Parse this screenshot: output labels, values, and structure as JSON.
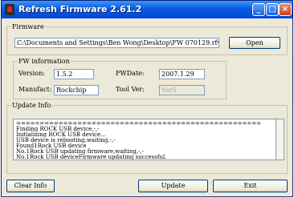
{
  "window": {
    "title": "Refresh Firmware 2.61.2",
    "minimize_glyph": "_",
    "maximize_glyph": "□",
    "close_glyph": "×"
  },
  "firmware": {
    "legend": "Firmware",
    "path": "C:\\Documents and Settings\\Ben Wong\\Desktop\\FW 070129.rfw",
    "open_label": "Open"
  },
  "fw_info": {
    "legend": "FW information",
    "version_label": "Version:",
    "version_value": "1.5.2",
    "manufact_label": "Manufact:",
    "manufact_value": "Rockchip",
    "fwdate_label": "FWDate:",
    "fwdate_value": "2007.1.29",
    "toolver_label": "Tool Ver:",
    "toolver_value": "Ver5"
  },
  "update_info": {
    "legend": "Update Info",
    "lines": [
      "====================================================",
      "Finding ROCK USB device,-,-",
      "Initializing ROCK USB device...",
      "USB device is rebooting,waiting,-,-",
      "Found1Rock USB device",
      "No.1Rock USB updating firmware,waiting,-,-",
      "No.1Rock USB deviceFirmware updating successful."
    ]
  },
  "buttons": {
    "clear": "Clear Info",
    "update": "Update",
    "exit": "Exit"
  }
}
